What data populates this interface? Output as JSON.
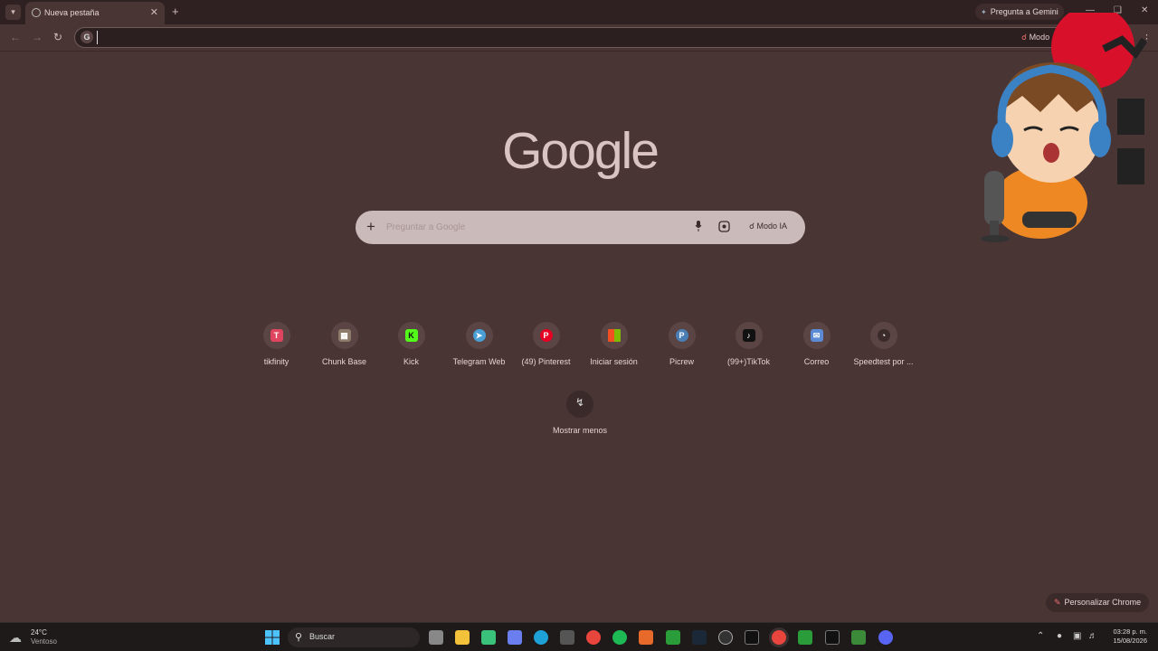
{
  "tab": {
    "title": "Nueva pestaña"
  },
  "gemini": {
    "label": "Pregunta a Gemini"
  },
  "omnibox": {
    "value": "",
    "modo_label": "Modo"
  },
  "google": {
    "logo_text": "Google"
  },
  "search": {
    "placeholder": "Preguntar a Google",
    "ai_mode_label": "Modo IA"
  },
  "shortcuts": [
    {
      "label": "tikfinity",
      "icon": "tikfinity-icon",
      "color": "#e0455f"
    },
    {
      "label": "Chunk Base",
      "icon": "chunkbase-icon",
      "color": "#8c7a6a"
    },
    {
      "label": "Kick",
      "icon": "kick-icon",
      "color": "#53fc18"
    },
    {
      "label": "Telegram Web",
      "icon": "telegram-icon",
      "color": "#4a9fd5"
    },
    {
      "label": "(49) Pinterest",
      "icon": "pinterest-icon",
      "color": "#e60023"
    },
    {
      "label": "Iniciar sesión",
      "icon": "microsoft-icon",
      "color": "#f25022"
    },
    {
      "label": "Picrew",
      "icon": "picrew-icon",
      "color": "#4a7fb5"
    },
    {
      "label": "(99+)TikTok",
      "icon": "tiktok-icon",
      "color": "#111111"
    },
    {
      "label": "Correo",
      "icon": "mail-icon",
      "color": "#5b8bd5"
    },
    {
      "label": "Speedtest por ...",
      "icon": "speedtest-icon",
      "color": "#3a2a2a"
    }
  ],
  "show_less": {
    "label": "Mostrar menos"
  },
  "customize": {
    "label": "Personalizar Chrome"
  },
  "taskbar": {
    "weather_temp": "24°C",
    "weather_desc": "Ventoso",
    "search_label": "Buscar",
    "time": "03:28 p. m.",
    "date": "15/08/2026"
  },
  "colors": {
    "background": "#4a3535",
    "accent": "#f07070"
  }
}
